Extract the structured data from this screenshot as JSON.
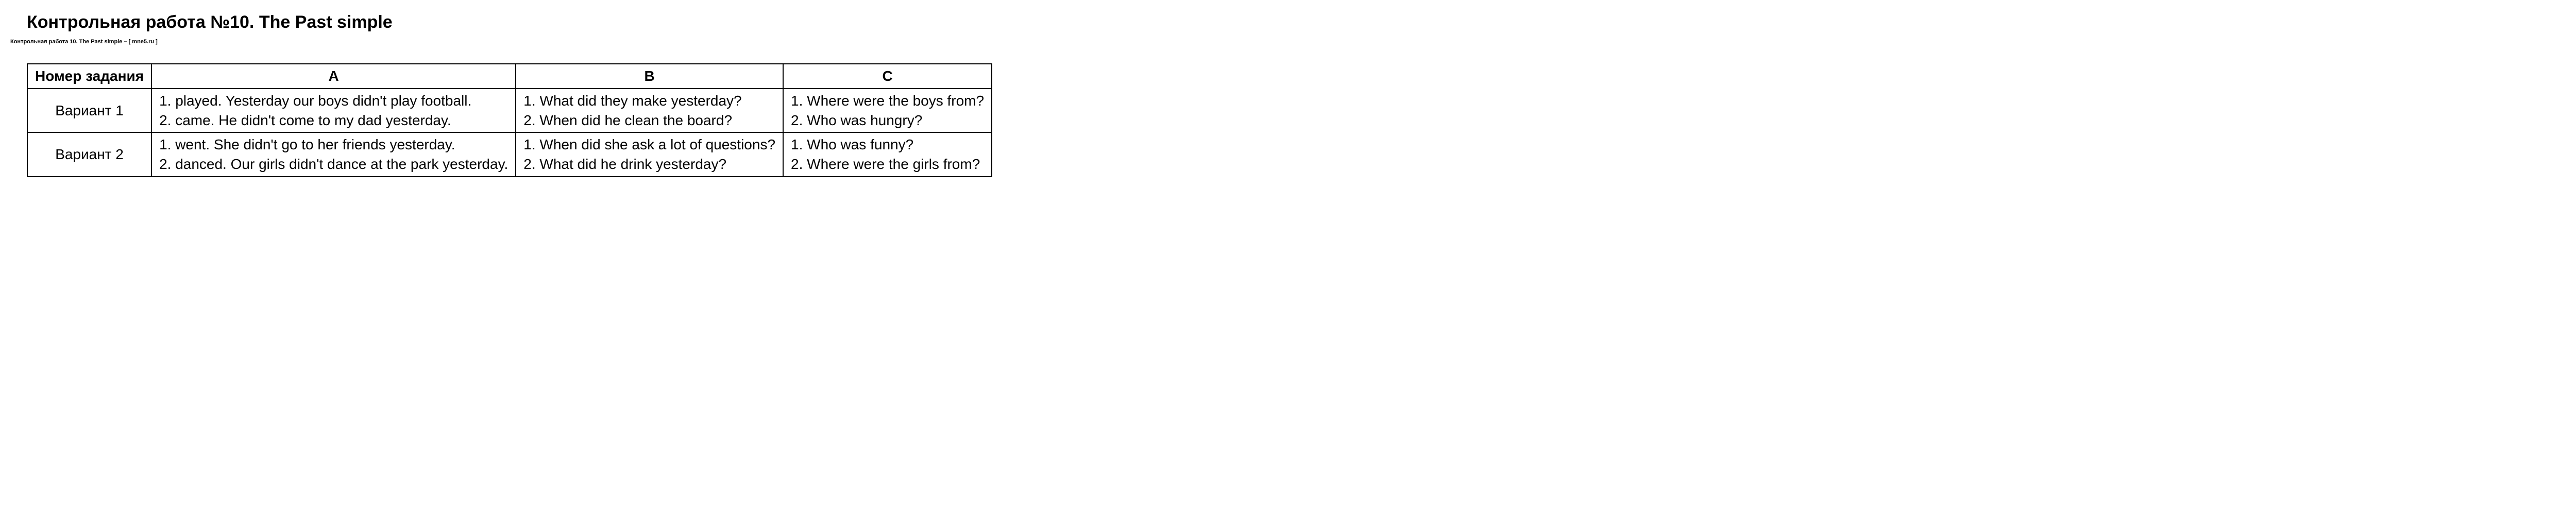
{
  "title": "Контрольная работа №10. The Past simple",
  "subtitle": "Контрольная работа 10. The Past simple  –  [ mne5.ru ]",
  "table": {
    "headers": {
      "num": "Номер задания",
      "a": "A",
      "b": "B",
      "c": "C"
    },
    "rows": [
      {
        "label": "Вариант 1",
        "a1": "1. played. Yesterday our boys didn't play football.",
        "a2": "2. came. He didn't come to my dad yesterday.",
        "b1": "1. What did they make yesterday?",
        "b2": "2. When did he clean the board?",
        "c1": "1. Where were the boys from?",
        "c2": "2. Who was hungry?"
      },
      {
        "label": "Вариант 2",
        "a1": "1. went. She didn't go to her friends yesterday.",
        "a2": "2. danced. Our girls didn't dance at the park yesterday.",
        "b1": "1. When did she ask a lot of questions?",
        "b2": "2. What did he drink yesterday?",
        "c1": "1. Who was funny?",
        "c2": "2. Where were the girls from?"
      }
    ]
  }
}
